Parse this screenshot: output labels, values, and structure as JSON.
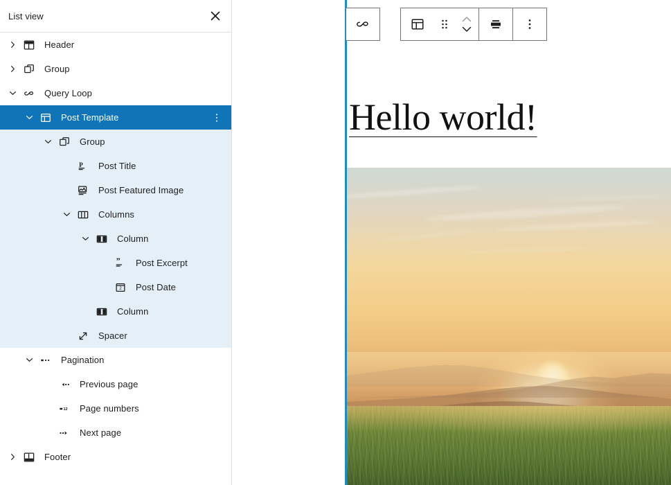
{
  "list_view": {
    "title": "List view",
    "close_icon": "close-icon",
    "items": [
      {
        "label": "Header",
        "icon": "header-block-icon",
        "depth": 0,
        "expander": "collapsed",
        "state": "normal"
      },
      {
        "label": "Group",
        "icon": "group-block-icon",
        "depth": 0,
        "expander": "collapsed",
        "state": "normal"
      },
      {
        "label": "Query Loop",
        "icon": "query-loop-block-icon",
        "depth": 0,
        "expander": "expanded",
        "state": "normal"
      },
      {
        "label": "Post Template",
        "icon": "post-template-block-icon",
        "depth": 1,
        "expander": "expanded",
        "state": "selected",
        "has_options": true,
        "options_icon": "more-vertical-icon"
      },
      {
        "label": "Group",
        "icon": "group-block-icon",
        "depth": 2,
        "expander": "expanded",
        "state": "branch"
      },
      {
        "label": "Post Title",
        "icon": "post-title-block-icon",
        "depth": 3,
        "expander": "none",
        "state": "branch"
      },
      {
        "label": "Post Featured Image",
        "icon": "post-featured-image-block-icon",
        "depth": 3,
        "expander": "none",
        "state": "branch"
      },
      {
        "label": "Columns",
        "icon": "columns-block-icon",
        "depth": 3,
        "expander": "expanded",
        "state": "branch"
      },
      {
        "label": "Column",
        "icon": "column-block-icon",
        "depth": 4,
        "expander": "expanded",
        "state": "branch"
      },
      {
        "label": "Post Excerpt",
        "icon": "post-excerpt-block-icon",
        "depth": 5,
        "expander": "none",
        "state": "branch"
      },
      {
        "label": "Post Date",
        "icon": "post-date-block-icon",
        "depth": 5,
        "expander": "none",
        "state": "branch"
      },
      {
        "label": "Column",
        "icon": "column-block-icon",
        "depth": 4,
        "expander": "none",
        "state": "branch"
      },
      {
        "label": "Spacer",
        "icon": "spacer-block-icon",
        "depth": 3,
        "expander": "none",
        "state": "branch"
      },
      {
        "label": "Pagination",
        "icon": "pagination-block-icon",
        "depth": 1,
        "expander": "expanded",
        "state": "normal"
      },
      {
        "label": "Previous page",
        "icon": "previous-page-block-icon",
        "depth": 2,
        "expander": "none",
        "state": "normal"
      },
      {
        "label": "Page numbers",
        "icon": "page-numbers-block-icon",
        "depth": 2,
        "expander": "none",
        "state": "normal"
      },
      {
        "label": "Next page",
        "icon": "next-page-block-icon",
        "depth": 2,
        "expander": "none",
        "state": "normal"
      },
      {
        "label": "Footer",
        "icon": "footer-block-icon",
        "depth": 0,
        "expander": "collapsed",
        "state": "normal"
      }
    ]
  },
  "toolbar": {
    "parent_button": {
      "name": "select-parent-query-loop",
      "icon": "query-loop-block-icon",
      "tooltip": "Select Query Loop"
    },
    "buttons": [
      {
        "name": "block-type-post-template",
        "icon": "post-template-block-icon",
        "tooltip": "Post Template"
      },
      {
        "name": "drag-handle",
        "icon": "drag-dots-icon",
        "tooltip": "Drag"
      },
      {
        "name": "move-updown",
        "icon": "chevron-up-down-icon",
        "tooltip": "Move up or down"
      },
      {
        "name": "align",
        "icon": "align-center-icon",
        "tooltip": "Align"
      },
      {
        "name": "more-options",
        "icon": "more-vertical-icon",
        "tooltip": "Options"
      }
    ]
  },
  "canvas": {
    "post_title": "Hello world!",
    "featured_image_alt": "Sunset over a mountain meadow with golden sky"
  },
  "colors": {
    "selected_row_bg": "#0f75b8",
    "branch_row_bg": "#e4eff7",
    "selection_line": "#1e8cbe",
    "panel_border": "#e0e0e0",
    "text": "#1e1e1e",
    "toolbar_border": "#757575"
  }
}
